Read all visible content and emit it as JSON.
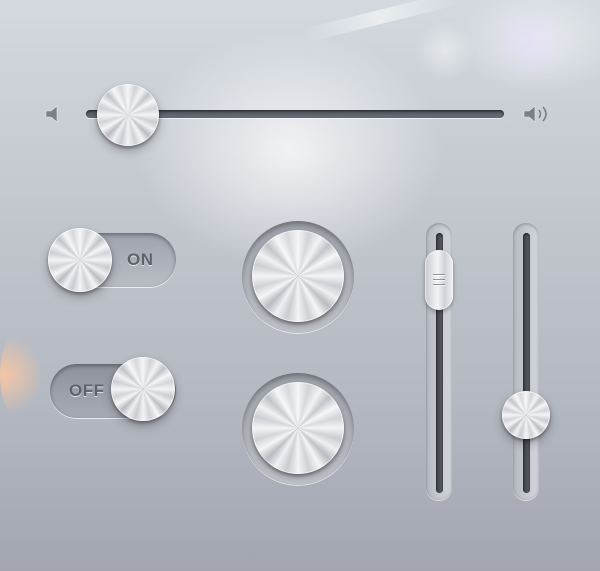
{
  "volume": {
    "level": 0.1,
    "min_icon": "speaker-low-icon",
    "max_icon": "speaker-high-icon"
  },
  "toggles": [
    {
      "label": "ON",
      "state": "on"
    },
    {
      "label": "OFF",
      "state": "off"
    }
  ],
  "knobs": [
    {
      "icon": "metal-knob"
    },
    {
      "icon": "metal-knob"
    }
  ],
  "vertical_sliders": [
    {
      "level": 0.82,
      "thumb_style": "rounded-rect"
    },
    {
      "level": 0.3,
      "thumb_style": "round"
    }
  ],
  "colors": {
    "background": "#c3c8cf",
    "track": "#4a4f58",
    "label": "#5e626b"
  }
}
